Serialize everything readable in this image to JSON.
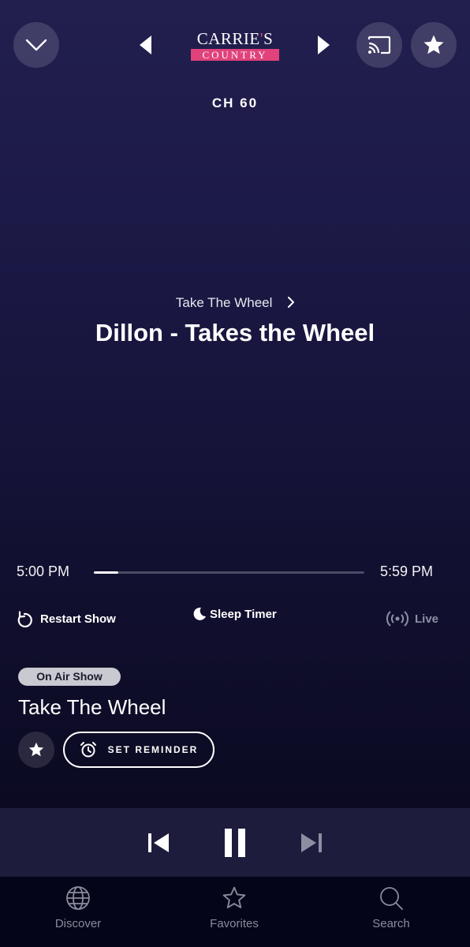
{
  "header": {
    "logo_line1": "CARRIE",
    "logo_apostrophe": "'",
    "logo_line1_end": "S",
    "logo_line2": "COUNTRY",
    "channel": "CH 60"
  },
  "now_playing": {
    "show_link": "Take The Wheel",
    "track_title": "Dillon - Takes the Wheel",
    "start_time": "5:00 PM",
    "end_time": "5:59 PM",
    "progress_fraction": 0.09
  },
  "actions": {
    "restart": "Restart Show",
    "sleep_timer": "Sleep Timer",
    "live": "Live"
  },
  "on_air": {
    "badge": "On Air Show",
    "title": "Take The Wheel",
    "reminder_label": "SET REMINDER"
  },
  "tabs": [
    {
      "label": "Discover",
      "icon": "globe-icon"
    },
    {
      "label": "Favorites",
      "icon": "star-outline-icon"
    },
    {
      "label": "Search",
      "icon": "search-icon"
    }
  ],
  "colors": {
    "accent": "#e0427c",
    "background_top": "#221f4f",
    "background_bottom": "#07071a",
    "playback_bar": "#1e1c3c"
  }
}
